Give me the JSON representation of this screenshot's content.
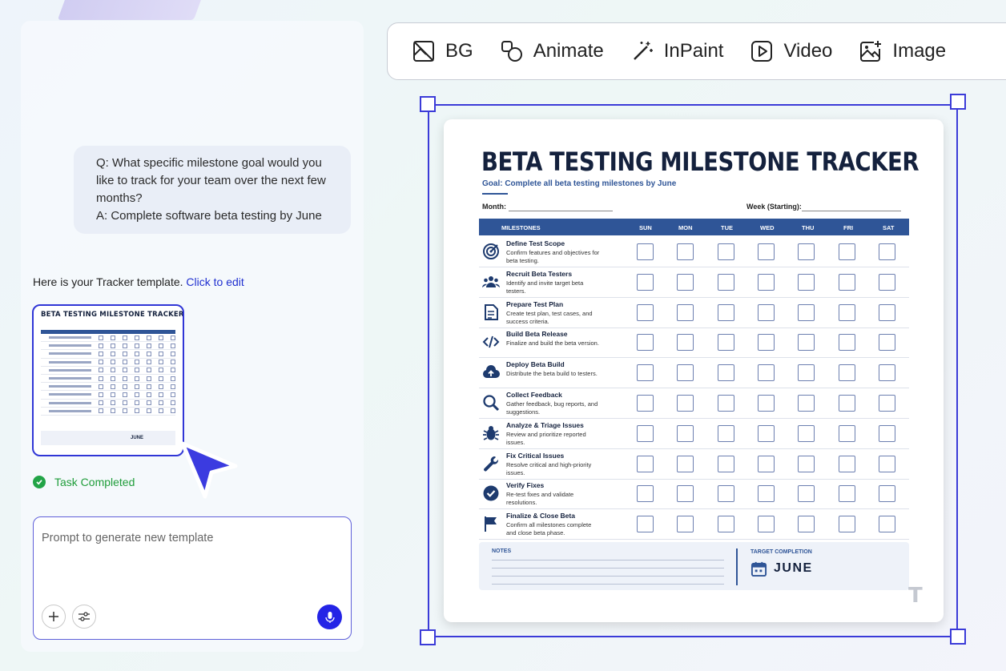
{
  "chat": {
    "question_lines": [
      "Q: What specific milestone goal would you",
      "like to track for your team over the next few",
      "months?",
      "A: Complete software beta testing by June"
    ],
    "tracker_message": "Here is your Tracker template.",
    "edit_link": "Click to edit",
    "task_status": "Task Completed",
    "prompt_placeholder": "Prompt to generate new template",
    "thumbnail_title": "BETA TESTING MILESTONE TRACKER",
    "thumbnail_target": "JUNE"
  },
  "toolbar": {
    "items": [
      {
        "label": "BG",
        "icon": "remove-background-icon"
      },
      {
        "label": "Animate",
        "icon": "animate-icon"
      },
      {
        "label": "InPaint",
        "icon": "magic-wand-icon"
      },
      {
        "label": "Video",
        "icon": "play-icon"
      },
      {
        "label": "Image",
        "icon": "image-plus-icon"
      }
    ]
  },
  "document": {
    "title": "BETA TESTING MILESTONE TRACKER",
    "goal": "Goal: Complete all beta testing milestones by June",
    "month_label": "Month:",
    "week_label": "Week (Starting):",
    "columns": [
      "MILESTONES",
      "SUN",
      "MON",
      "TUE",
      "WED",
      "THU",
      "FRI",
      "SAT"
    ],
    "milestones": [
      {
        "name": "Define Test Scope",
        "desc": "Confirm features and objectives for beta testing.",
        "icon": "target-icon"
      },
      {
        "name": "Recruit Beta Testers",
        "desc": "Identify and invite target beta testers.",
        "icon": "people-icon"
      },
      {
        "name": "Prepare Test Plan",
        "desc": "Create test plan, test cases, and success criteria.",
        "icon": "document-icon"
      },
      {
        "name": "Build Beta Release",
        "desc": "Finalize and build the beta version.",
        "icon": "code-icon"
      },
      {
        "name": "Deploy Beta Build",
        "desc": "Distribute the beta build to testers.",
        "icon": "cloud-upload-icon"
      },
      {
        "name": "Collect Feedback",
        "desc": "Gather feedback, bug reports, and suggestions.",
        "icon": "magnifier-icon"
      },
      {
        "name": "Analyze & Triage Issues",
        "desc": "Review and prioritize reported issues.",
        "icon": "bug-icon"
      },
      {
        "name": "Fix Critical Issues",
        "desc": "Resolve critical and high-priority issues.",
        "icon": "wrench-icon"
      },
      {
        "name": "Verify Fixes",
        "desc": "Re-test fixes and validate resolutions.",
        "icon": "check-circle-icon"
      },
      {
        "name": "Finalize & Close Beta",
        "desc": "Confirm all milestones complete and close beta phase.",
        "icon": "flag-icon"
      }
    ],
    "notes_label": "NOTES",
    "target_label": "TARGET COMPLETION",
    "target_value": "JUNE",
    "watermark": "T"
  },
  "colors": {
    "accent": "#2424e6",
    "doc_blue": "#2f5597",
    "success": "#22a447"
  }
}
